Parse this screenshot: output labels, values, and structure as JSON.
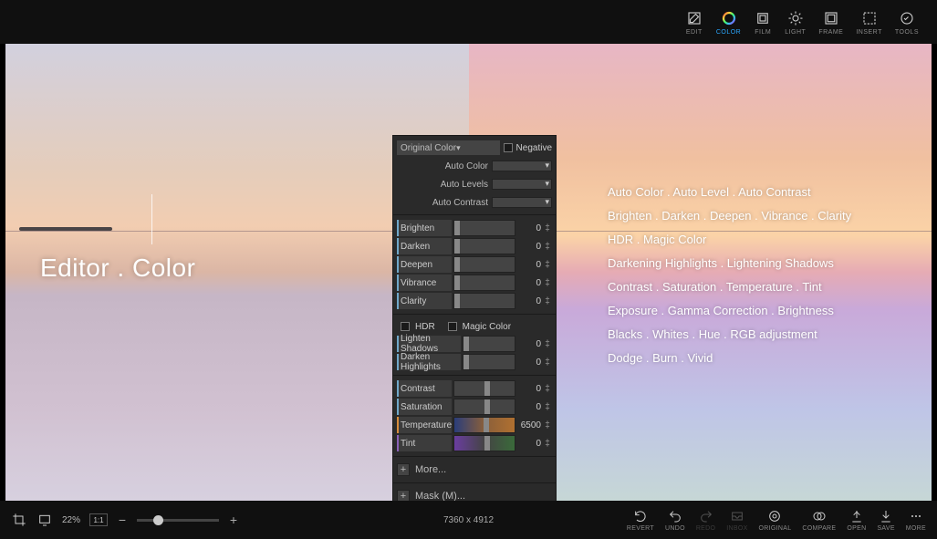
{
  "topbar": {
    "items": [
      {
        "id": "edit",
        "label": "EDIT"
      },
      {
        "id": "color",
        "label": "COLOR",
        "active": true
      },
      {
        "id": "film",
        "label": "FILM"
      },
      {
        "id": "light",
        "label": "LIGHT"
      },
      {
        "id": "frame",
        "label": "FRAME"
      },
      {
        "id": "insert",
        "label": "INSERT"
      },
      {
        "id": "tools",
        "label": "TOOLS"
      }
    ]
  },
  "hero": {
    "title": "Editor . Color"
  },
  "features": [
    "Auto Color . Auto Level . Auto Contrast",
    "Brighten . Darken . Deepen . Vibrance . Clarity",
    "HDR . Magic Color",
    "Darkening Highlights . Lightening Shadows",
    "Contrast . Saturation . Temperature . Tint",
    "Exposure . Gamma Correction . Brightness",
    "Blacks . Whites . Hue . RGB adjustment",
    "Dodge . Burn . Vivid"
  ],
  "panel": {
    "mode": "Original Color",
    "negative_label": "Negative",
    "auto": [
      {
        "label": "Auto Color"
      },
      {
        "label": "Auto Levels"
      },
      {
        "label": "Auto Contrast"
      }
    ],
    "group1": [
      {
        "name": "Brighten",
        "value": "0"
      },
      {
        "name": "Darken",
        "value": "0"
      },
      {
        "name": "Deepen",
        "value": "0"
      },
      {
        "name": "Vibrance",
        "value": "0"
      },
      {
        "name": "Clarity",
        "value": "0"
      }
    ],
    "hdr_label": "HDR",
    "magic_label": "Magic Color",
    "group2": [
      {
        "name": "Lighten Shadows",
        "value": "0"
      },
      {
        "name": "Darken Highlights",
        "value": "0"
      }
    ],
    "group3": [
      {
        "name": "Contrast",
        "value": "0",
        "thumb": 50
      },
      {
        "name": "Saturation",
        "value": "0",
        "thumb": 50
      },
      {
        "name": "Temperature",
        "value": "6500",
        "thumb": 48,
        "cls": "temp"
      },
      {
        "name": "Tint",
        "value": "0",
        "thumb": 50,
        "cls": "tint"
      }
    ],
    "more_label": "More...",
    "mask_label": "Mask (M)..."
  },
  "bottombar": {
    "zoom": "22%",
    "ratio": "1:1",
    "dimensions": "7360 x 4912",
    "actions": [
      {
        "id": "revert",
        "label": "REVERT"
      },
      {
        "id": "undo",
        "label": "UNDO"
      },
      {
        "id": "redo",
        "label": "REDO",
        "disabled": true
      },
      {
        "id": "inbox",
        "label": "INBOX",
        "disabled": true
      },
      {
        "id": "original",
        "label": "ORIGINAL"
      },
      {
        "id": "compare",
        "label": "COMPARE"
      },
      {
        "id": "open",
        "label": "OPEN"
      },
      {
        "id": "save",
        "label": "SAVE"
      },
      {
        "id": "more",
        "label": "MORE"
      }
    ]
  }
}
